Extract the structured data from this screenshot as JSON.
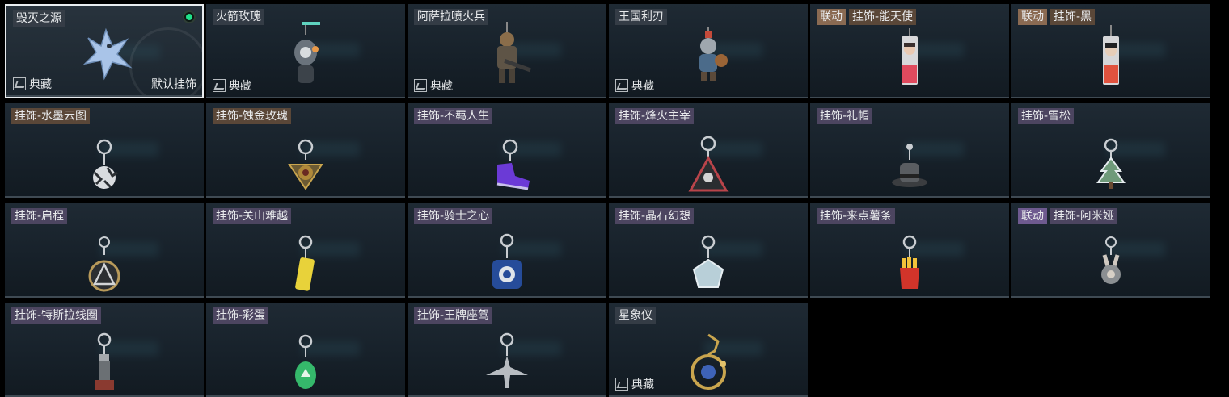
{
  "badge_label": "典藏",
  "default_label": "默认挂饰",
  "collab_label": "联动",
  "colors": {
    "equipped": "#1fe08a",
    "selected_border": "#e9edf0",
    "collab_purple": "#6e5a8f",
    "collab_red": "#8a6a52"
  },
  "cards": [
    {
      "name": "毁灭之源",
      "icon": "dragon-icon",
      "collection": true,
      "selected": true,
      "equipped": true,
      "default": true
    },
    {
      "name": "火箭玫瑰",
      "icon": "robot-figure-icon",
      "collection": true
    },
    {
      "name": "阿萨拉喷火兵",
      "icon": "soldier-figure-icon",
      "collection": true
    },
    {
      "name": "王国利刃",
      "icon": "knight-figure-icon",
      "collection": true
    },
    {
      "name": "挂饰-能天使",
      "icon": "chibi-angel-icon",
      "collab": true
    },
    {
      "name": "挂饰-黑",
      "icon": "chibi-black-icon",
      "collab": true
    },
    {
      "name": "挂饰-水墨云图",
      "icon": "ball-charm-icon"
    },
    {
      "name": "挂饰-蚀金玫瑰",
      "icon": "gold-rose-charm-icon"
    },
    {
      "name": "挂饰-不羁人生",
      "icon": "sneaker-charm-icon"
    },
    {
      "name": "挂饰-烽火主宰",
      "icon": "triangle-badge-icon"
    },
    {
      "name": "挂饰-礼帽",
      "icon": "top-hat-charm-icon"
    },
    {
      "name": "挂饰-雪松",
      "icon": "pine-tree-charm-icon"
    },
    {
      "name": "挂饰-启程",
      "icon": "ring-emblem-icon"
    },
    {
      "name": "挂饰-关山难越",
      "icon": "yellow-bar-charm-icon"
    },
    {
      "name": "挂饰-骑士之心",
      "icon": "blue-shield-charm-icon"
    },
    {
      "name": "挂饰-晶石幻想",
      "icon": "crystal-cube-icon"
    },
    {
      "name": "挂饰-来点薯条",
      "icon": "fries-charm-icon"
    },
    {
      "name": "挂饰-阿米娅",
      "icon": "bunny-charm-icon",
      "collab": true
    },
    {
      "name": "挂饰-特斯拉线圈",
      "icon": "tesla-coil-icon"
    },
    {
      "name": "挂饰-彩蛋",
      "icon": "green-egg-charm-icon"
    },
    {
      "name": "挂饰-王牌座驾",
      "icon": "jet-plane-charm-icon"
    },
    {
      "name": "星象仪",
      "icon": "astrolabe-icon",
      "collection": true
    }
  ]
}
